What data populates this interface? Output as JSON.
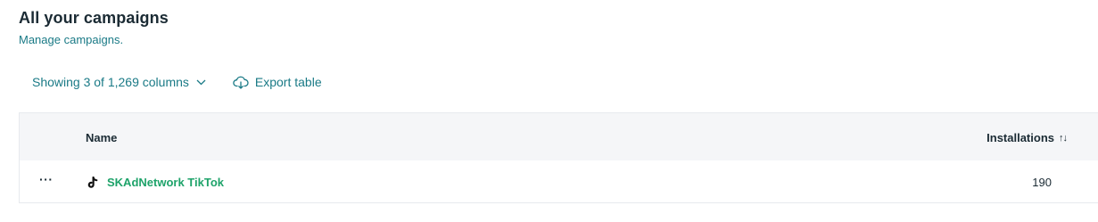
{
  "header": {
    "title": "All your campaigns",
    "subtitle": "Manage campaigns."
  },
  "toolbar": {
    "columns_label": "Showing 3 of 1,269 columns",
    "export_label": "Export table"
  },
  "table": {
    "columns": {
      "name": "Name",
      "installations": "Installations"
    },
    "rows": [
      {
        "menu": "···",
        "name": "SKAdNetwork TikTok",
        "icon": "tiktok-icon",
        "installations": "190"
      }
    ]
  },
  "colors": {
    "title": "#1b2b34",
    "link": "#1a7a86",
    "campaign_name": "#1ea36a",
    "header_bg": "#f5f6f8"
  }
}
